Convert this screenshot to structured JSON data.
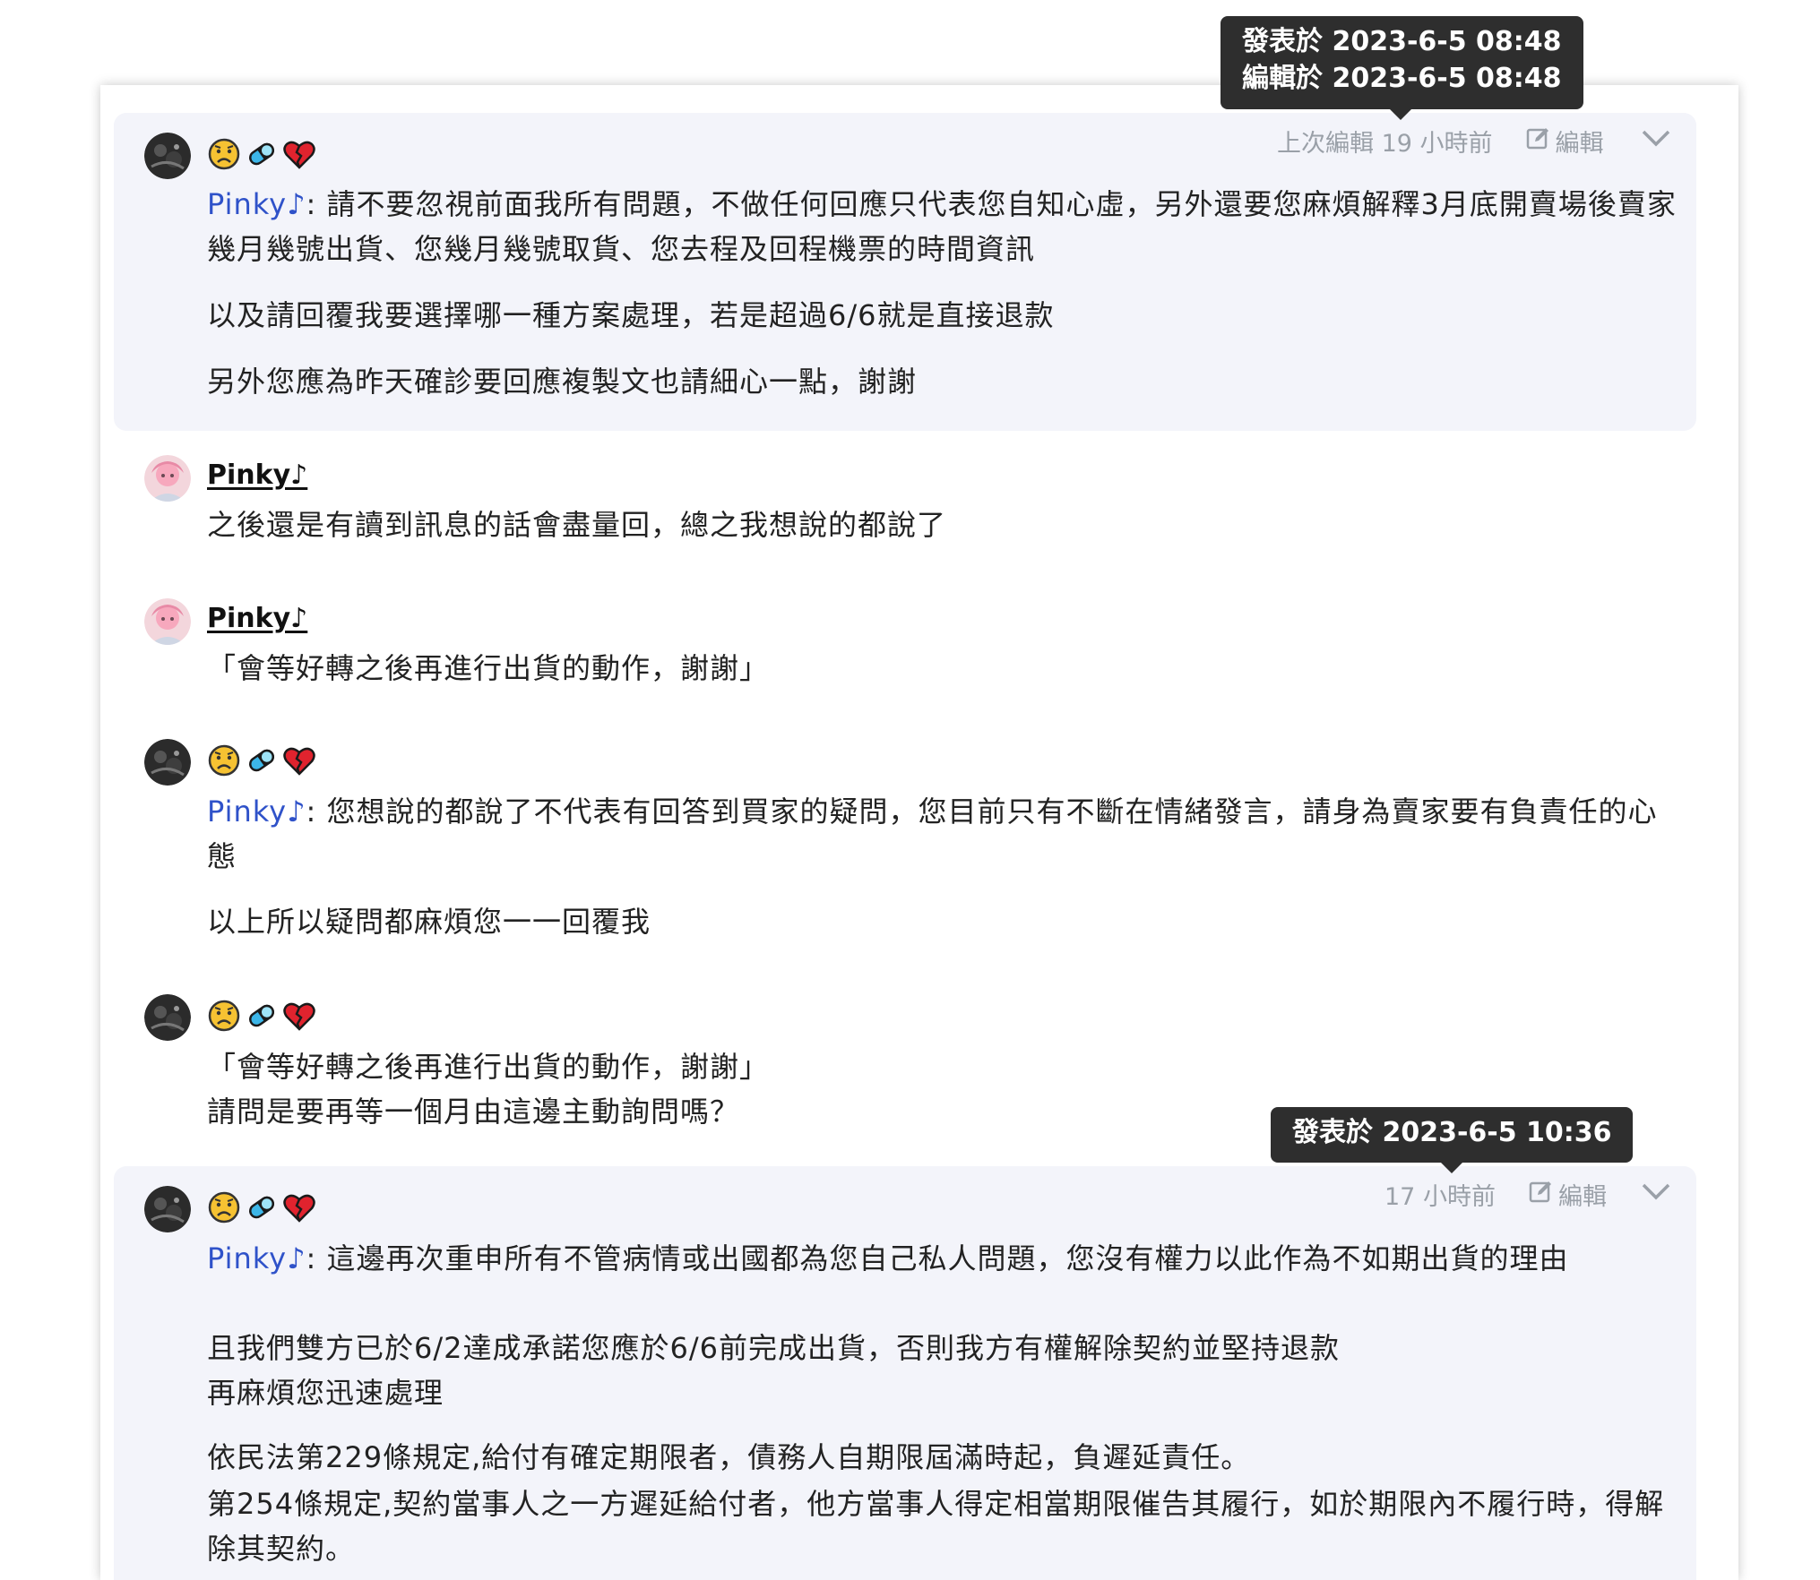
{
  "tooltips": {
    "first": {
      "line1": "發表於 2023-6-5 08:48",
      "line2": "編輯於 2023-6-5 08:48"
    },
    "second": {
      "line1": "發表於 2023-6-5 10:36"
    }
  },
  "colors": {
    "mention": "#2f52c9",
    "highlight_bg": "#f3f4fa",
    "meta": "#9aa0a8"
  },
  "icons": [
    "sad-face-icon",
    "pill-icon",
    "broken-heart-icon",
    "edit-icon",
    "chevron-down-icon"
  ],
  "comments": [
    {
      "meta": {
        "time": "上次編輯 19 小時前",
        "edit_label": "編輯"
      },
      "mention": "Pinky♪",
      "paragraphs": [
        ": 請不要忽視前面我所有問題，不做任何回應只代表您自知心虛，另外還要您麻煩解釋3月底開賣場後賣家幾月幾號出貨、您幾月幾號取貨、您去程及回程機票的時間資訊",
        "以及請回覆我要選擇哪一種方案處理，若是超過6/6就是直接退款",
        "另外您應為昨天確診要回應複製文也請細心一點，謝謝"
      ]
    },
    {
      "username": "Pinky♪",
      "paragraphs": [
        "之後還是有讀到訊息的話會盡量回，總之我想說的都說了"
      ]
    },
    {
      "username": "Pinky♪",
      "paragraphs": [
        "「會等好轉之後再進行出貨的動作，謝謝」"
      ]
    },
    {
      "mention": "Pinky♪",
      "paragraphs": [
        ": 您想說的都說了不代表有回答到買家的疑問，您目前只有不斷在情緒發言，請身為賣家要有負責任的心態",
        "以上所以疑問都麻煩您一一回覆我"
      ]
    },
    {
      "paragraphs": [
        "「會等好轉之後再進行出貨的動作，謝謝」",
        "請問是要再等一個月由這邊主動詢問嗎？"
      ]
    },
    {
      "meta": {
        "time": "17 小時前",
        "edit_label": "編輯"
      },
      "mention": "Pinky♪",
      "paragraphs": [
        ": 這邊再次重申所有不管病情或出國都為您自己私人問題，您沒有權力以此作為不如期出貨的理由",
        "且我們雙方已於6/2達成承諾您應於6/6前完成出貨，否則我方有權解除契約並堅持退款",
        "再麻煩您迅速處理",
        "依民法第229條規定,給付有確定期限者，債務人自期限屆滿時起，負遲延責任。",
        "第254條規定,契約當事人之一方遲延給付者，他方當事人得定相當期限催告其履行，如於期限內不履行時，得解除其契約。"
      ]
    }
  ]
}
